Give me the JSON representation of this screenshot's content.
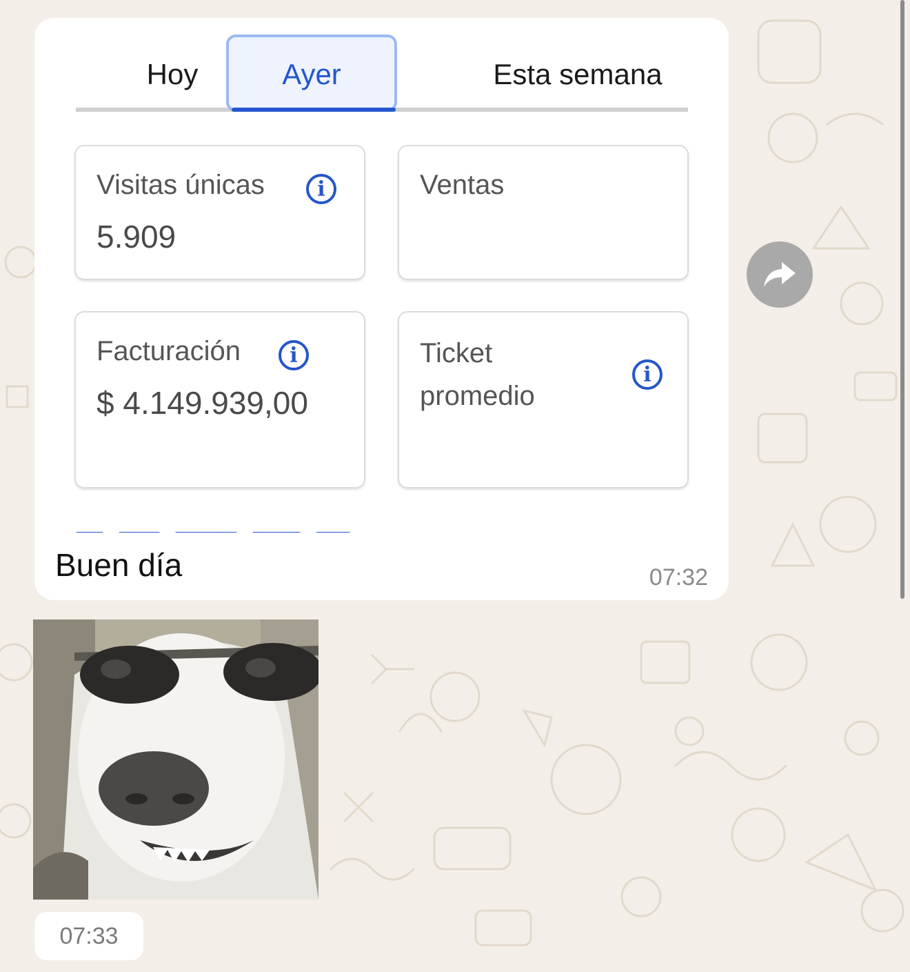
{
  "chat": {
    "image_message": {
      "tabs": [
        {
          "label": "Hoy",
          "selected": false
        },
        {
          "label": "Ayer",
          "selected": true
        },
        {
          "label": "Esta semana",
          "selected": false
        }
      ],
      "cards": {
        "visitas": {
          "title": "Visitas únicas",
          "value": "5.909",
          "info_icon": "info-icon"
        },
        "ventas": {
          "title": "Ventas",
          "value": ""
        },
        "facturacion": {
          "title": "Facturación",
          "value": "$ 4.149.939,00",
          "info_icon": "info-icon"
        },
        "ticket": {
          "title_line1": "Ticket",
          "title_line2": "promedio",
          "value": "",
          "info_icon": "info-icon"
        }
      },
      "caption": "Buen día",
      "time": "07:32"
    },
    "forward_button_icon": "forward-arrow-icon",
    "sticker_message": {
      "sticker": "dog-with-sunglasses-sticker",
      "time": "07:33"
    }
  },
  "colors": {
    "accent": "#2456cc",
    "tab_selected_bg": "#eef3fd",
    "chat_bg": "#f3efe8",
    "bubble_bg": "#ffffff"
  }
}
